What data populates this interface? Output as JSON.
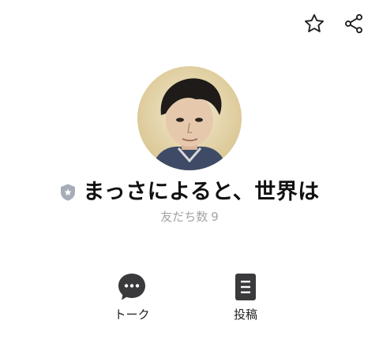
{
  "header": {
    "favorite_icon": "star-outline-icon",
    "share_icon": "share-icon"
  },
  "profile": {
    "name": "まっさによると、世界は",
    "badge_icon": "official-shield-icon",
    "friends_label": "友だち数",
    "friends_count": "9"
  },
  "actions": [
    {
      "label": "トーク",
      "icon": "chat-bubble-icon"
    },
    {
      "label": "投稿",
      "icon": "post-document-icon"
    }
  ],
  "colors": {
    "text": "#111111",
    "subtext": "#a3a3a3",
    "icon_dark": "#3a3a3c",
    "badge": "#a7adb8"
  }
}
